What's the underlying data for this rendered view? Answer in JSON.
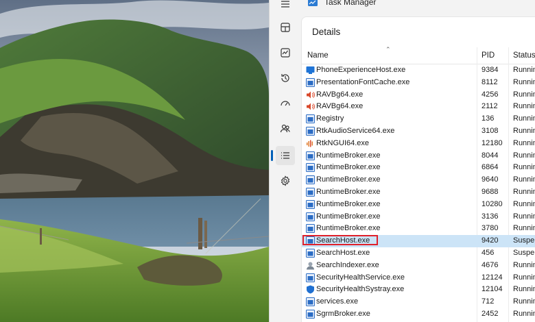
{
  "window": {
    "title": "Task Manager",
    "page_title": "Details"
  },
  "nav": {
    "items": [
      {
        "icon": "hamburger-menu-icon"
      },
      {
        "icon": "processes-icon"
      },
      {
        "icon": "performance-icon"
      },
      {
        "icon": "app-history-icon"
      },
      {
        "icon": "startup-apps-icon"
      },
      {
        "icon": "users-icon"
      },
      {
        "icon": "details-icon",
        "active": true
      },
      {
        "icon": "services-icon"
      }
    ]
  },
  "columns": {
    "name": "Name",
    "pid": "PID",
    "status": "Status"
  },
  "rows": [
    {
      "name": "PhoneExperienceHost.exe",
      "pid": "9384",
      "status": "Running",
      "icon": "phone-icon"
    },
    {
      "name": "PresentationFontCache.exe",
      "pid": "8112",
      "status": "Running",
      "icon": "app-icon"
    },
    {
      "name": "RAVBg64.exe",
      "pid": "4256",
      "status": "Running",
      "icon": "speaker-icon"
    },
    {
      "name": "RAVBg64.exe",
      "pid": "2112",
      "status": "Running",
      "icon": "speaker-icon"
    },
    {
      "name": "Registry",
      "pid": "136",
      "status": "Running",
      "icon": "app-icon"
    },
    {
      "name": "RtkAudioService64.exe",
      "pid": "3108",
      "status": "Running",
      "icon": "app-icon"
    },
    {
      "name": "RtkNGUI64.exe",
      "pid": "12180",
      "status": "Running",
      "icon": "audio-bars-icon"
    },
    {
      "name": "RuntimeBroker.exe",
      "pid": "8044",
      "status": "Running",
      "icon": "app-icon"
    },
    {
      "name": "RuntimeBroker.exe",
      "pid": "6864",
      "status": "Running",
      "icon": "app-icon"
    },
    {
      "name": "RuntimeBroker.exe",
      "pid": "9640",
      "status": "Running",
      "icon": "app-icon"
    },
    {
      "name": "RuntimeBroker.exe",
      "pid": "9688",
      "status": "Running",
      "icon": "app-icon"
    },
    {
      "name": "RuntimeBroker.exe",
      "pid": "10280",
      "status": "Running",
      "icon": "app-icon"
    },
    {
      "name": "RuntimeBroker.exe",
      "pid": "3136",
      "status": "Running",
      "icon": "app-icon"
    },
    {
      "name": "RuntimeBroker.exe",
      "pid": "3780",
      "status": "Running",
      "icon": "app-icon"
    },
    {
      "name": "SearchHost.exe",
      "pid": "9420",
      "status": "Suspended",
      "icon": "app-icon",
      "selected": true
    },
    {
      "name": "SearchHost.exe",
      "pid": "456",
      "status": "Suspended",
      "icon": "app-icon"
    },
    {
      "name": "SearchIndexer.exe",
      "pid": "4676",
      "status": "Running",
      "icon": "indexer-icon"
    },
    {
      "name": "SecurityHealthService.exe",
      "pid": "12124",
      "status": "Running",
      "icon": "app-icon"
    },
    {
      "name": "SecurityHealthSystray.exe",
      "pid": "12104",
      "status": "Running",
      "icon": "shield-icon"
    },
    {
      "name": "services.exe",
      "pid": "712",
      "status": "Running",
      "icon": "app-icon"
    },
    {
      "name": "SgrmBroker.exe",
      "pid": "2452",
      "status": "Running",
      "icon": "app-icon"
    }
  ],
  "colors": {
    "accent": "#005fb8",
    "selection": "#cce4f7",
    "highlight_box": "#e0202a"
  }
}
